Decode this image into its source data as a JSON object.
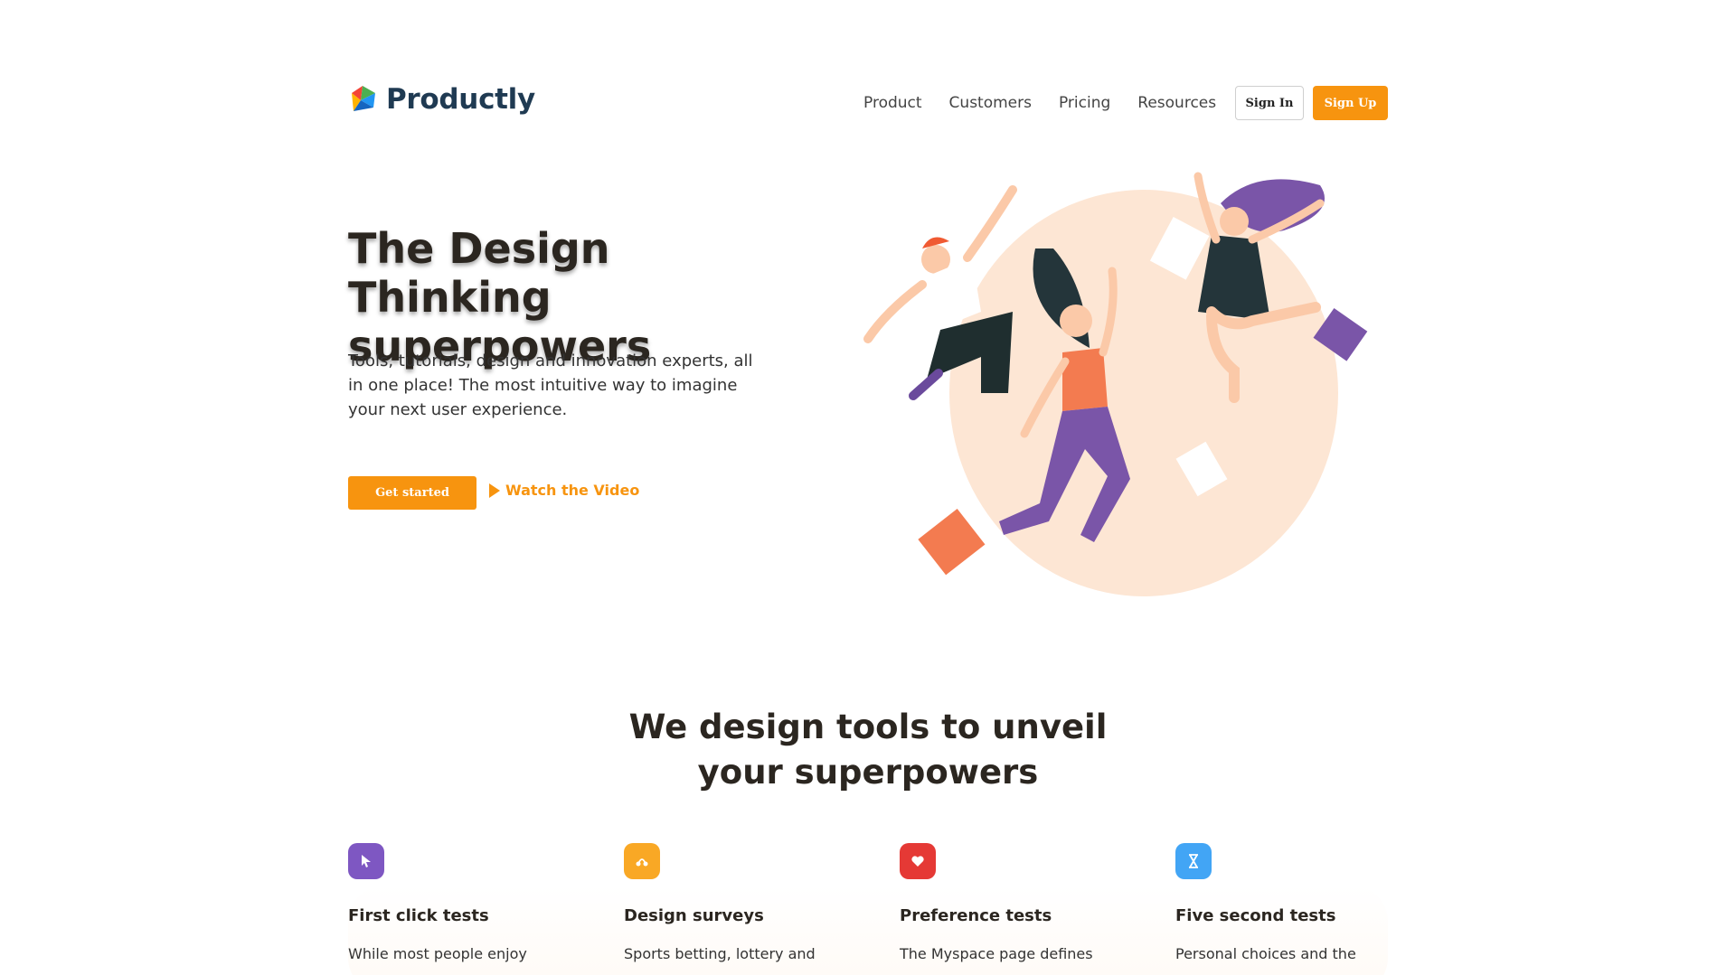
{
  "brand": {
    "name": "Productly"
  },
  "nav": {
    "items": [
      {
        "label": "Product"
      },
      {
        "label": "Customers"
      },
      {
        "label": "Pricing"
      },
      {
        "label": "Resources"
      }
    ],
    "sign_in": "Sign In",
    "sign_up": "Sign Up"
  },
  "hero": {
    "title": "The Design Thinking superpowers",
    "subtitle": "Tools, tutorials, design and innovation experts, all in one place! The most intuitive way to imagine your next user experience.",
    "cta_primary": "Get started",
    "cta_secondary": "Watch the Video"
  },
  "section": {
    "title": "We design tools to unveil your superpowers"
  },
  "features": [
    {
      "title": "First click tests",
      "text": "While most people enjoy",
      "icon": "cursor-icon",
      "color": "#7e57c2"
    },
    {
      "title": "Design surveys",
      "text": "Sports betting, lottery and",
      "icon": "survey-icon",
      "color": "#f9a825"
    },
    {
      "title": "Preference tests",
      "text": "The Myspace page defines",
      "icon": "heart-icon",
      "color": "#e53935"
    },
    {
      "title": "Five second tests",
      "text": "Personal choices and the",
      "icon": "hourglass-icon",
      "color": "#42a5f5"
    }
  ],
  "colors": {
    "accent": "#f7940f",
    "brand_text": "#1f3a52",
    "heading": "#2b2620"
  }
}
